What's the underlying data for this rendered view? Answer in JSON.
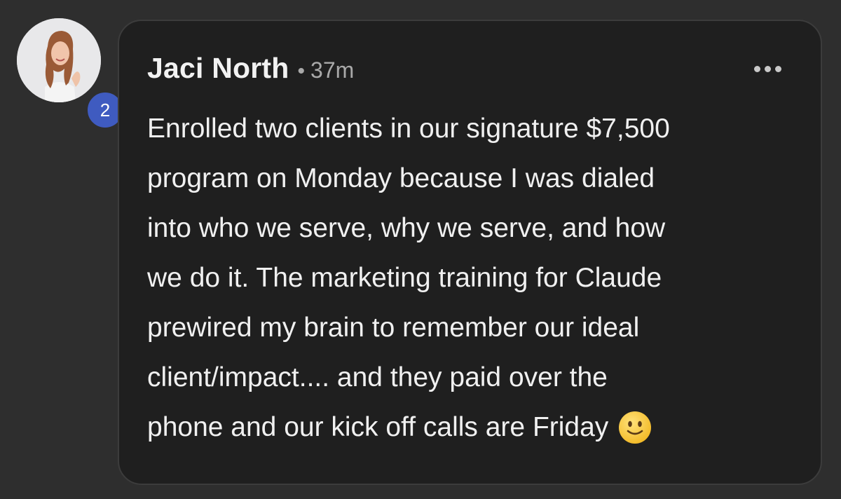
{
  "comment": {
    "author": "Jaci North",
    "separator": "•",
    "time": "37m",
    "level": "2",
    "body_lines": [
      "Enrolled two clients in our signature $7,500",
      "program on Monday because I was dialed",
      "into who we serve, why we serve, and how",
      "we do it. The marketing training for Claude",
      "prewired my brain to remember our ideal",
      "client/impact.... and they paid over the",
      "phone and our kick off calls are Friday"
    ],
    "trailing_emoji": "slightly-smiling-face-emoji",
    "more_icon": "more-horizontal-icon"
  },
  "colors": {
    "background": "#2e2e2e",
    "bubble": "#1f1f1f",
    "badge": "#3f5bc0",
    "emoji": "#f7c948"
  }
}
